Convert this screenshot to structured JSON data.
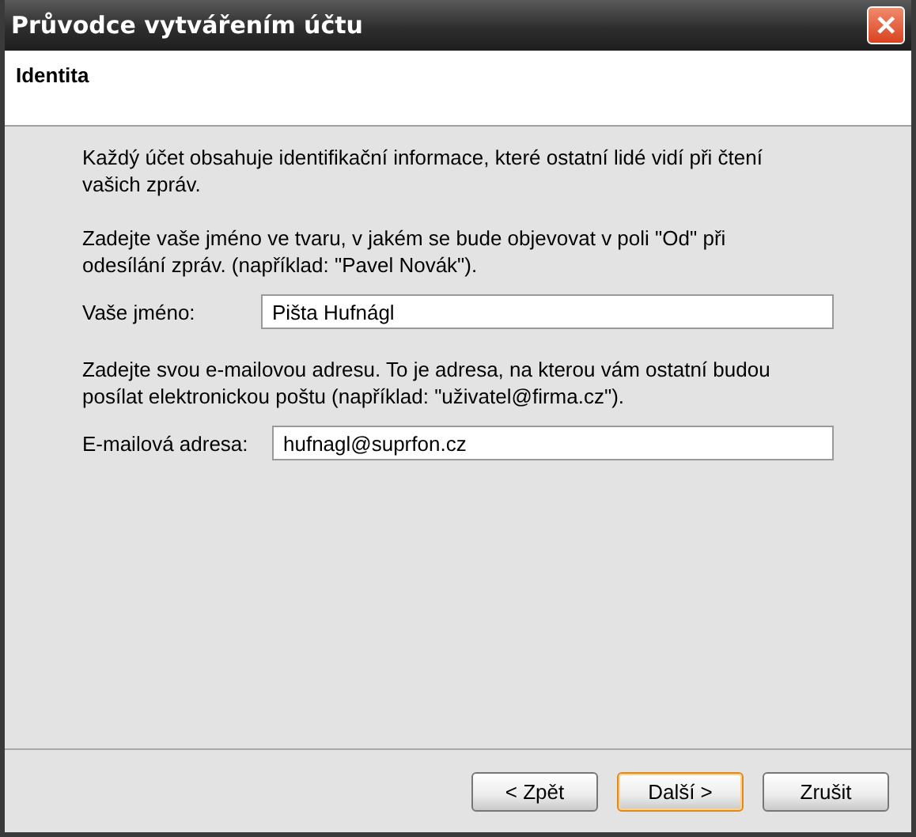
{
  "window": {
    "title": "Průvodce vytvářením účtu",
    "close_label": "✕"
  },
  "header": {
    "title": "Identita"
  },
  "paragraphs": [
    "Každý účet obsahuje identifikační informace, které ostatní lidé vidí při čtení vašich zpráv."
  ],
  "fields": [
    {
      "intro": "Zadejte vaše jméno ve tvaru, v jakém se bude objevovat v poli \"Od\" při odesílání zpráv. (například: \"Pavel Novák\").",
      "label": "Vaše jméno:",
      "value": "Pišta Hufnágl"
    },
    {
      "intro": "Zadejte svou e-mailovou adresu. To je adresa, na kterou vám ostatní budou posílat elektronickou poštu (například: \"uživatel@firma.cz\").",
      "label": "E-mailová adresa:",
      "value": "hufnagl@suprfon.cz"
    }
  ],
  "buttons": [
    {
      "label": "< Zpět",
      "default": false
    },
    {
      "label": "Další >",
      "default": true
    },
    {
      "label": "Zrušit",
      "default": false
    }
  ]
}
